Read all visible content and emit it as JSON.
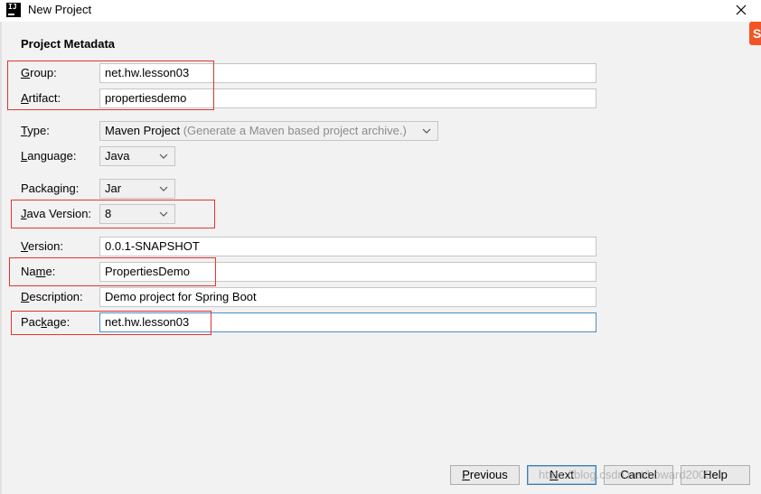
{
  "window": {
    "icon_text": "IJ",
    "title": "New Project"
  },
  "side_logo": "S",
  "section": {
    "title": "Project Metadata"
  },
  "fields": {
    "group": {
      "mnemonic": "G",
      "label_rest": "roup:",
      "value": "net.hw.lesson03"
    },
    "artifact": {
      "mnemonic": "A",
      "label_rest": "rtifact:",
      "value": "propertiesdemo"
    },
    "type": {
      "mnemonic": "T",
      "label_rest": "ype:",
      "value": "Maven Project",
      "hint": "(Generate a Maven based project archive.)"
    },
    "language": {
      "mnemonic": "L",
      "label_rest": "anguage:",
      "value": "Java"
    },
    "packaging": {
      "label_pre": "Packa",
      "mnemonic": "g",
      "label_rest": "ing:",
      "value": "Jar"
    },
    "java_version": {
      "mnemonic": "J",
      "label_rest": "ava Version:",
      "value": "8"
    },
    "version": {
      "mnemonic": "V",
      "label_rest": "ersion:",
      "value": "0.0.1-SNAPSHOT"
    },
    "name": {
      "label_pre": "Na",
      "mnemonic": "m",
      "label_rest": "e:",
      "value": "PropertiesDemo"
    },
    "description": {
      "mnemonic": "D",
      "label_rest": "escription:",
      "value": "Demo project for Spring Boot"
    },
    "package": {
      "label_pre": "Pac",
      "mnemonic": "k",
      "label_rest": "age:",
      "value": "net.hw.lesson03"
    }
  },
  "buttons": {
    "previous": {
      "mnemonic": "P",
      "label_rest": "revious"
    },
    "next": {
      "mnemonic": "N",
      "label_rest": "ext"
    },
    "cancel": {
      "label": "Cancel"
    },
    "help": {
      "label": "Help"
    }
  },
  "watermark": "https://blog.csdn.net/howard2005",
  "colors": {
    "annotation": "#e3342f",
    "focus_border": "#4a90c8",
    "hint_text": "#8c8c8c",
    "logo": "#f25525"
  }
}
